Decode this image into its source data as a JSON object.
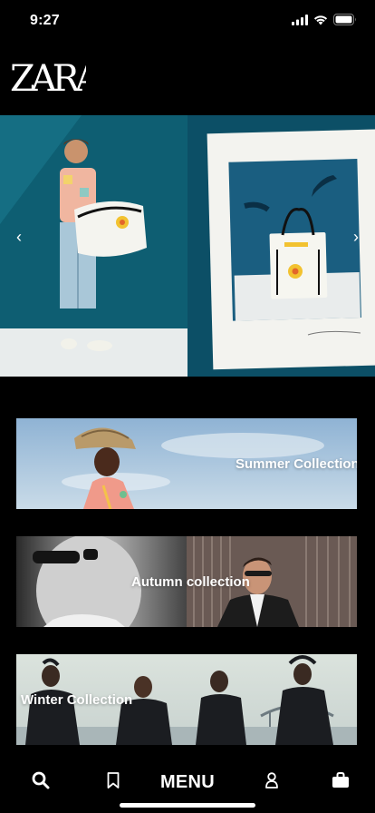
{
  "status_bar": {
    "time": "9:27",
    "icons": [
      "signal-icon",
      "wifi-icon",
      "battery-icon"
    ]
  },
  "brand": {
    "logo_text": "ZARA"
  },
  "hero": {
    "prev_icon": "chevron-left-icon",
    "next_icon": "chevron-right-icon",
    "arrow_prev": "‹",
    "arrow_next": "›"
  },
  "collections": [
    {
      "label": "Summer Collection"
    },
    {
      "label": "Autumn collection"
    },
    {
      "label": "Winter Collection"
    }
  ],
  "bottom_nav": {
    "menu_label": "MENU",
    "icons": [
      "search-icon",
      "bookmark-icon",
      "user-icon",
      "shopping-bag-icon"
    ]
  },
  "colors": {
    "background": "#000000",
    "text": "#ffffff",
    "hero_teal": "#0b5f74"
  }
}
